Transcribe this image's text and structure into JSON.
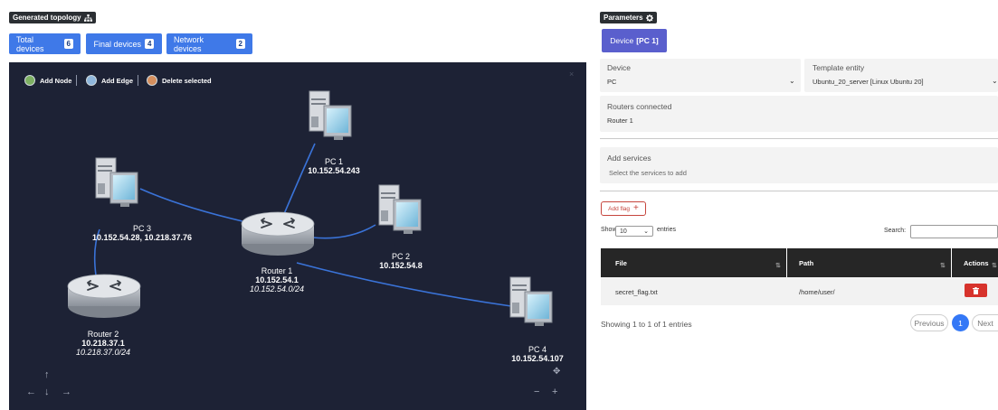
{
  "topology": {
    "header": "Generated topology",
    "counts": [
      {
        "label": "Total devices",
        "value": "6"
      },
      {
        "label": "Final devices",
        "value": "4"
      },
      {
        "label": "Network devices",
        "value": "2"
      }
    ],
    "tools": {
      "add_node": "Add Node",
      "add_edge": "Add Edge",
      "delete_selected": "Delete selected"
    },
    "close": "×",
    "nodes": {
      "pc1": {
        "name": "PC 1",
        "ip": "10.152.54.243"
      },
      "pc2": {
        "name": "PC 2",
        "ip": "10.152.54.8"
      },
      "pc3": {
        "name": "PC 3",
        "ip": "10.152.54.28, 10.218.37.76"
      },
      "pc4": {
        "name": "PC 4",
        "ip": "10.152.54.107"
      },
      "router1": {
        "name": "Router 1",
        "ip": "10.152.54.1",
        "net": "10.152.54.0/24"
      },
      "router2": {
        "name": "Router 2",
        "ip": "10.218.37.1",
        "net": "10.218.37.0/24"
      }
    },
    "nav": {
      "up": "↑",
      "down": "↓",
      "left": "←",
      "right": "→",
      "fit": "✥",
      "zoom_out": "−",
      "zoom_in": "+"
    }
  },
  "params": {
    "header": "Parameters",
    "tab": {
      "prefix": "Device",
      "name": "[PC 1]"
    },
    "device_label": "Device",
    "device_value": "PC",
    "template_label": "Template entity",
    "template_value": "Ubuntu_20_server [Linux Ubuntu 20]",
    "routers_label": "Routers connected",
    "routers_value": "Router 1",
    "services_label": "Add services",
    "services_placeholder": "Select the services to add",
    "add_flag": "Add flag",
    "show": "Show",
    "entries_value": "10",
    "entries": "entries",
    "search": "Search:",
    "table": {
      "columns": [
        "File",
        "Path",
        "Actions"
      ],
      "rows": [
        {
          "file": "secret_flag.txt",
          "path": "/home/user/"
        }
      ]
    },
    "info": "Showing 1 to 1 of 1 entries",
    "pagination": {
      "previous": "Previous",
      "current": "1",
      "next": "Next"
    }
  }
}
